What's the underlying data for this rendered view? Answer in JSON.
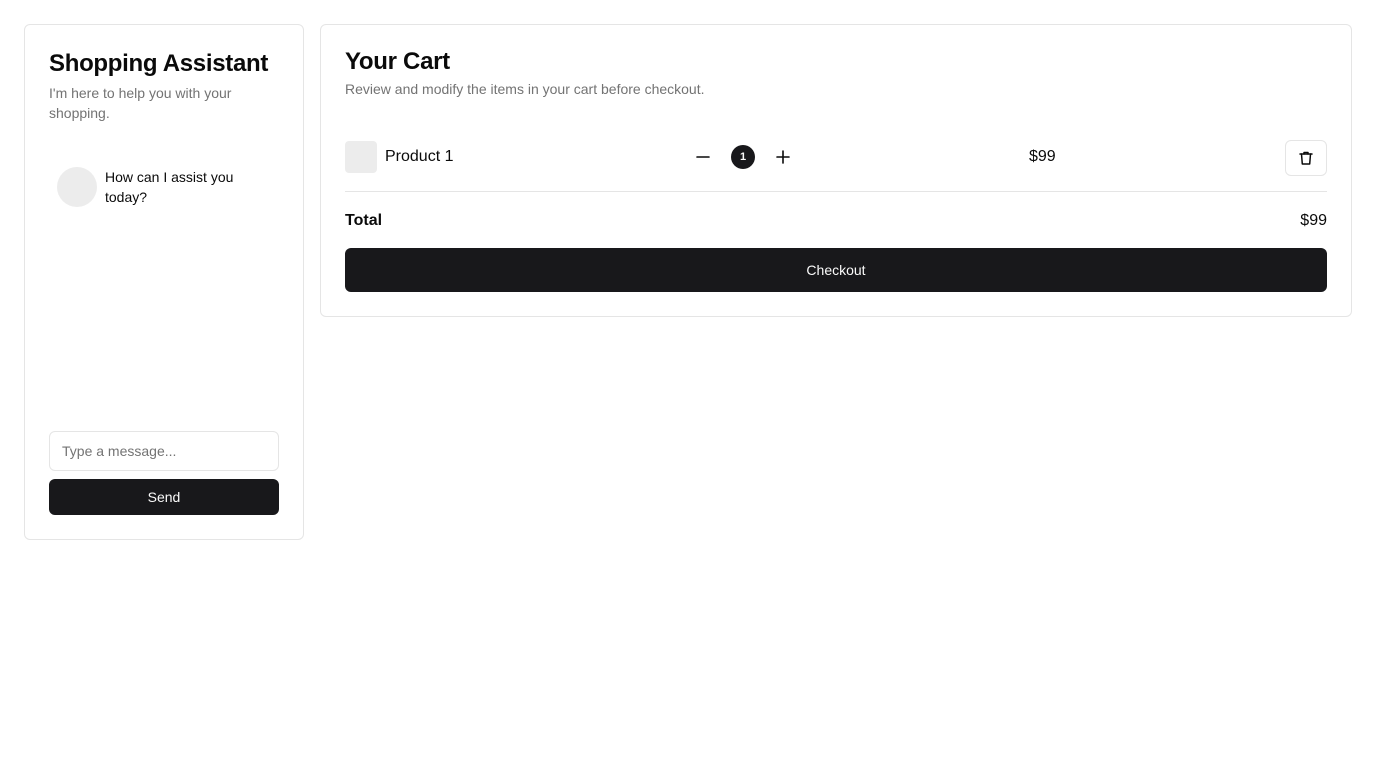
{
  "assistant": {
    "title": "Shopping Assistant",
    "subtitle": "I'm here to help you with your shopping.",
    "messages": [
      {
        "text": "How can I assist you today?"
      }
    ],
    "input": {
      "placeholder": "Type a message...",
      "value": ""
    },
    "send_label": "Send"
  },
  "cart": {
    "title": "Your Cart",
    "subtitle": "Review and modify the items in your cart before checkout.",
    "items": [
      {
        "name": "Product 1",
        "quantity": "1",
        "price": "$99",
        "decrement_icon": "minus-icon",
        "increment_icon": "plus-icon",
        "remove_icon": "trash-icon"
      }
    ],
    "total_label": "Total",
    "total_value": "$99",
    "checkout_label": "Checkout"
  },
  "colors": {
    "primary": "#18181b",
    "border": "#e5e5e5",
    "muted_text": "#737373",
    "placeholder_bg": "#ececec"
  }
}
